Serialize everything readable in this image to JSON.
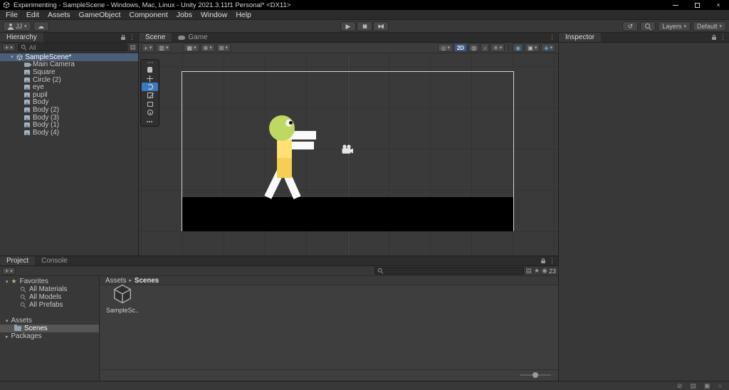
{
  "window": {
    "title": "Experimenting - SampleScene - Windows, Mac, Linux - Unity 2021.3.11f1 Personal* <DX11>",
    "close_glyph": "×"
  },
  "menu": {
    "items": [
      "File",
      "Edit",
      "Assets",
      "GameObject",
      "Component",
      "Jobs",
      "Window",
      "Help"
    ]
  },
  "toolbar": {
    "account_label": "JJ",
    "layers_label": "Layers",
    "layout_label": "Default"
  },
  "icons": {
    "caret": "▾",
    "caret_right": "▸",
    "kebab": "⋮",
    "play": "▶",
    "pause": "▮▮",
    "step": "▶▮",
    "history": "↺",
    "cloud": "☁",
    "star": "★",
    "shaded": "◐",
    "debug": "▥",
    "grid": "▦",
    "snap": "⊕",
    "snap_grid": "⊞",
    "sphere": "◎",
    "bulb": "◍",
    "audio": "♪",
    "fx": "✳",
    "eye": "◉",
    "camera": "▣",
    "gizmos": "◈",
    "search_in": "▤",
    "status": [
      "⊘",
      "▤",
      "▣",
      "○"
    ]
  },
  "hierarchy": {
    "tab": "Hierarchy",
    "add_label": "+",
    "search_placeholder": "All",
    "scene_name": "SampleScene*",
    "items": [
      "Main Camera",
      "Square",
      "Circle (2)",
      "eye",
      "pupil",
      "Body",
      "Body (2)",
      "Body (3)",
      "Body (1)",
      "Body (4)"
    ]
  },
  "scene": {
    "tab_scene": "Scene",
    "tab_game": "Game",
    "btn_2d": "2D",
    "tools": [
      "hand",
      "move",
      "rotate",
      "scale",
      "rect",
      "transform",
      "more"
    ],
    "colors": {
      "head": "#BDD962",
      "body_top": "#FFE070",
      "body_bottom": "#F6CE51",
      "limbs": "#FAFAFA",
      "ground": "#000000",
      "selection_blue": "#3E78C0"
    }
  },
  "inspector": {
    "tab": "Inspector"
  },
  "project": {
    "tab_project": "Project",
    "tab_console": "Console",
    "add_label": "+",
    "hidden_count": "23",
    "favorites_label": "Favorites",
    "favorite_items": [
      "All Materials",
      "All Models",
      "All Prefabs"
    ],
    "assets_label": "Assets",
    "scenes_folder": "Scenes",
    "packages_label": "Packages",
    "breadcrumb_root": "Assets",
    "breadcrumb_current": "Scenes",
    "asset_label": "SampleSc..."
  }
}
